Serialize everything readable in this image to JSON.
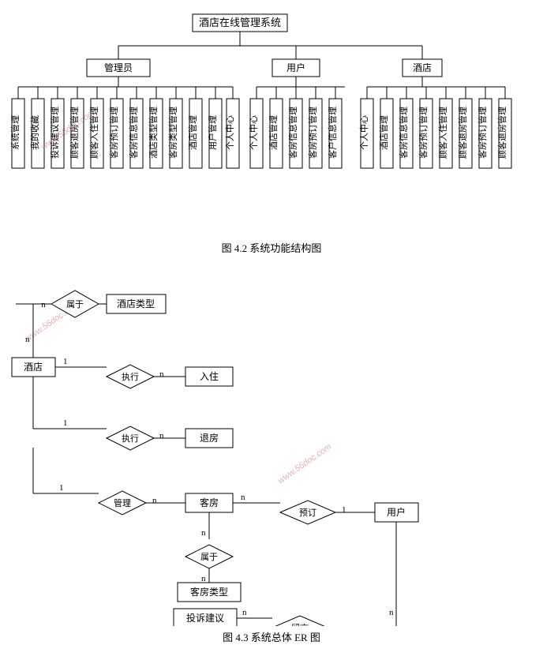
{
  "diagram1": {
    "root": "酒店在线管理系统",
    "caption": "图 4.2 系统功能结构图",
    "level2": [
      "管理员",
      "用户",
      "酒店"
    ],
    "admin_leaves": [
      "系统管理",
      "我的收藏",
      "投诉建议管理",
      "顾客退房管理",
      "顾客入住管理",
      "客房预订管理",
      "客房信息管理",
      "酒店类型管理",
      "客房类型管理",
      "酒店管理",
      "用户管理",
      "个人中心",
      "个人中心",
      "酒店管理",
      "客房信息管理",
      "客房预订管理"
    ],
    "user_leaves": [
      "个人中心",
      "个人中心",
      "酒店管理",
      "客房信息管理",
      "客房预订管理"
    ],
    "hotel_leaves": [
      "客房信息管理",
      "客房预订管理",
      "顾客入住管理",
      "顾客退房管理"
    ]
  },
  "diagram2": {
    "caption": "图 4.3 系统总体 ER 图",
    "nodes": {
      "hotelType": "酒店类型",
      "hotel": "酒店",
      "checkIn": "入住",
      "checkOut": "退房",
      "room": "客房",
      "user": "用户",
      "roomType": "客房类型",
      "complaint": "投诉建议",
      "message": "留言"
    },
    "relations": {
      "belongTo1": "属于",
      "execute1": "执行",
      "execute2": "执行",
      "manage": "管理",
      "reserve": "预订",
      "belongTo2": "属于"
    },
    "cardinalities": {
      "n": "n",
      "one": "1"
    }
  },
  "watermarks": [
    "www.56doc.com",
    "www.56doc.com"
  ]
}
